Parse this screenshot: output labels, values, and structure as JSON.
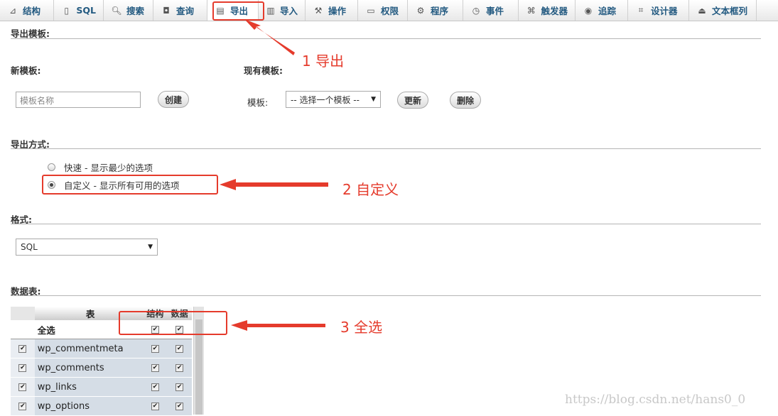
{
  "tabs": [
    {
      "icon": "structure-icon",
      "glyph": "⊿",
      "label": "结构"
    },
    {
      "icon": "sql-icon",
      "glyph": "▯",
      "label": "SQL"
    },
    {
      "icon": "search-icon",
      "glyph": "🔍︎",
      "label": "搜索"
    },
    {
      "icon": "query-icon",
      "glyph": "◘",
      "label": "查询"
    },
    {
      "icon": "export-icon",
      "glyph": "▤",
      "label": "导出"
    },
    {
      "icon": "import-icon",
      "glyph": "▥",
      "label": "导入"
    },
    {
      "icon": "operations-icon",
      "glyph": "⚒",
      "label": "操作"
    },
    {
      "icon": "privileges-icon",
      "glyph": "▭",
      "label": "权限"
    },
    {
      "icon": "routines-icon",
      "glyph": "⚙",
      "label": "程序"
    },
    {
      "icon": "events-icon",
      "glyph": "◷",
      "label": "事件"
    },
    {
      "icon": "triggers-icon",
      "glyph": "⌘",
      "label": "触发器"
    },
    {
      "icon": "tracking-icon",
      "glyph": "◉",
      "label": "追踪"
    },
    {
      "icon": "designer-icon",
      "glyph": "⌗",
      "label": "设计器"
    },
    {
      "icon": "central-columns-icon",
      "glyph": "⏏",
      "label": "文本框列"
    }
  ],
  "export_template": {
    "title": "导出模板:",
    "new_label": "新模板:",
    "existing_label": "现有模板:",
    "name_placeholder": "模板名称",
    "create_button": "创建",
    "template_label": "模板:",
    "template_select": "-- 选择一个模板 --",
    "update_button": "更新",
    "delete_button": "删除"
  },
  "export_method": {
    "title": "导出方式:",
    "quick": "快速 - 显示最少的选项",
    "custom": "自定义 - 显示所有可用的选项",
    "selected": "custom"
  },
  "format": {
    "title": "格式:",
    "value": "SQL"
  },
  "tables": {
    "title": "数据表:",
    "col_table": "表",
    "col_structure": "结构",
    "col_data": "数据",
    "select_all": "全选",
    "rows": [
      "wp_commentmeta",
      "wp_comments",
      "wp_links",
      "wp_options"
    ]
  },
  "annotations": {
    "a1": "1 导出",
    "a2": "2 自定义",
    "a3": "3 全选",
    "color": "#e53b2c"
  },
  "watermark": "https://blog.csdn.net/hans0_0"
}
